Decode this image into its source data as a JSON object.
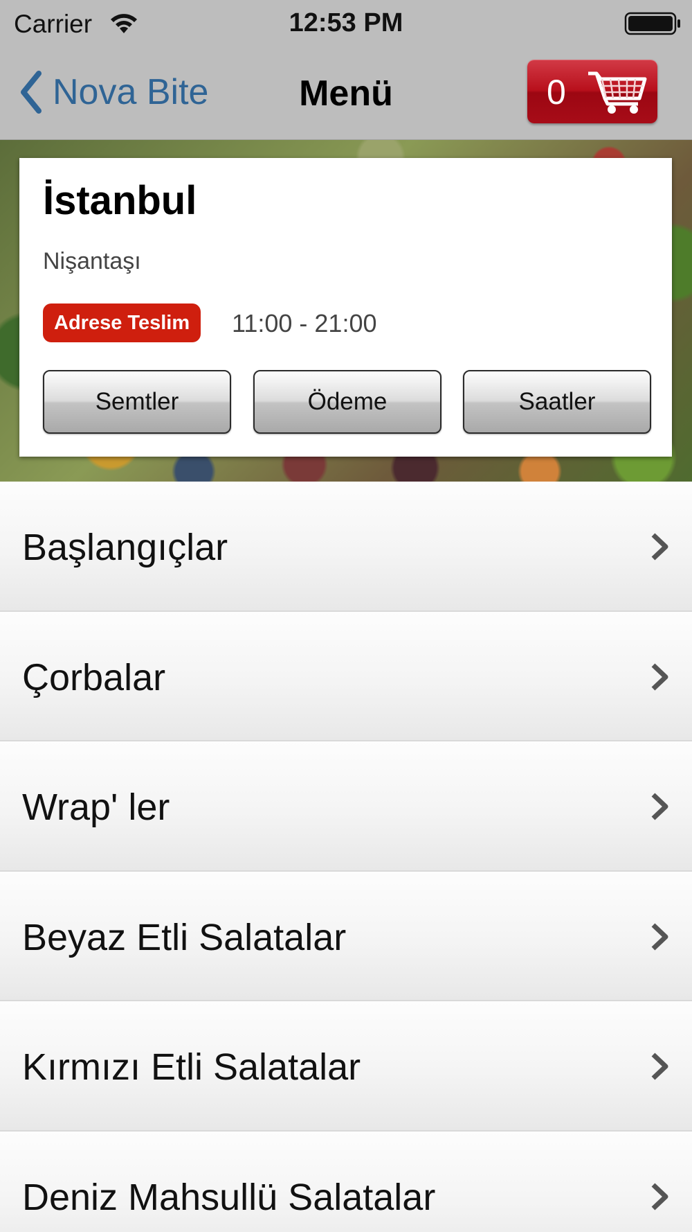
{
  "status_bar": {
    "carrier": "Carrier",
    "time": "12:53 PM",
    "wifi_icon": "wifi-icon",
    "battery_icon": "battery-icon"
  },
  "nav": {
    "back_label": "Nova Bite",
    "title": "Menü",
    "cart_count": "0",
    "cart_icon": "shopping-cart-icon",
    "back_color": "#2f6495",
    "cart_color": "#b8101c"
  },
  "restaurant": {
    "city": "İstanbul",
    "district": "Nişantaşı",
    "delivery_badge": "Adrese Teslim",
    "badge_color": "#cf1f0e",
    "hours": "11:00 - 21:00",
    "buttons": [
      "Semtler",
      "Ödeme",
      "Saatler"
    ]
  },
  "menu": {
    "categories": [
      "Başlangıçlar",
      "Çorbalar",
      "Wrap' ler",
      "Beyaz Etli Salatalar",
      "Kırmızı Etli Salatalar",
      "Deniz Mahsullü Salatalar"
    ],
    "chevron_icon": "chevron-right-icon"
  }
}
